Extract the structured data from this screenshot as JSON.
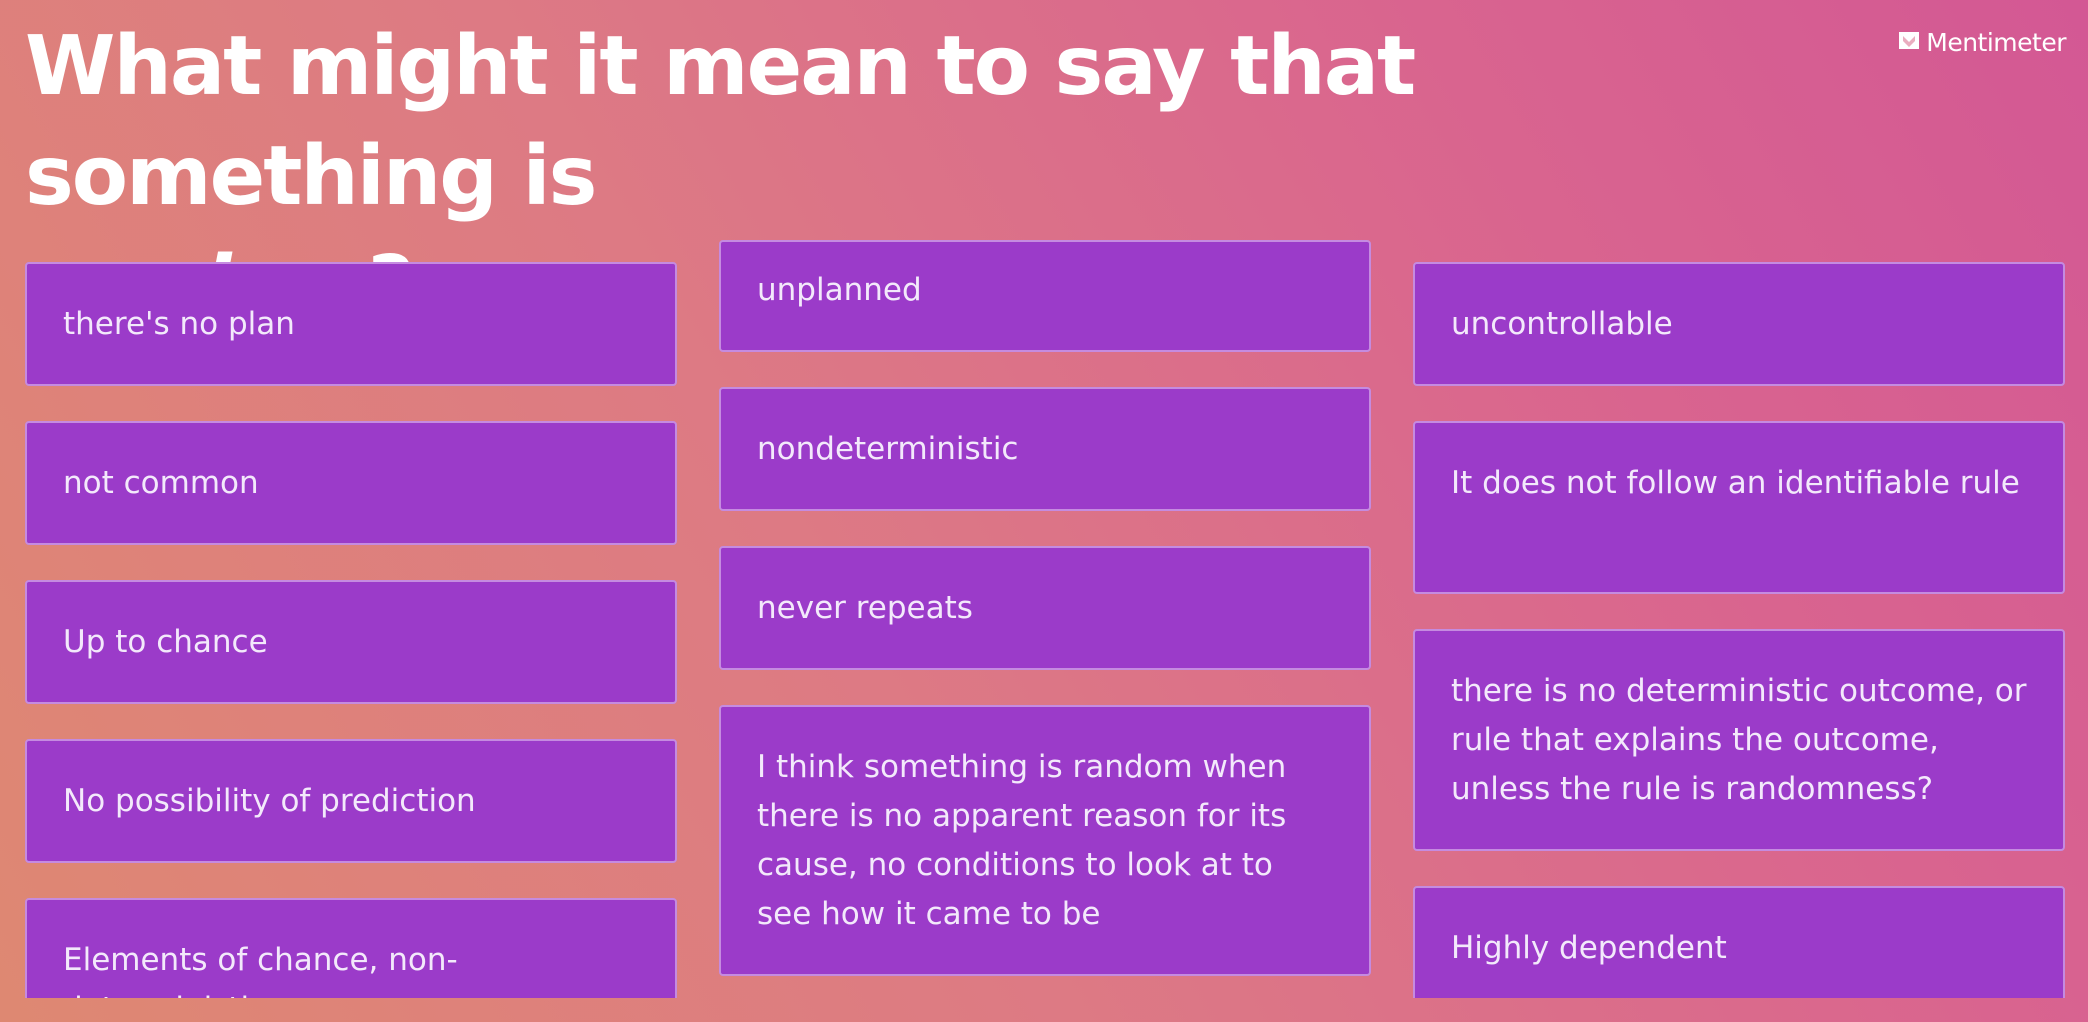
{
  "question": {
    "title_line1": "What might it mean to say that something is",
    "title_emphasis": "random",
    "title_end": "?"
  },
  "brand": {
    "name": "Mentimeter",
    "icon": "mentimeter-logo-icon"
  },
  "responses": {
    "column1": [
      "there's no plan",
      "not common",
      "Up to chance",
      "No possibility of prediction",
      "Elements of chance, non-deterministic"
    ],
    "column2": [
      "unplanned",
      "nondeterministic",
      "never repeats",
      "I think something is random when there is no apparent reason for its cause, no conditions to look at to see how it came to be"
    ],
    "column3": [
      "uncontrollable",
      "It does not follow an identifiable rule",
      "there is no deterministic outcome, or rule that explains the outcome, unless the rule is randomness?",
      "Highly dependent"
    ]
  },
  "colors": {
    "card_background": "#9b3bc9",
    "card_border": "#c58be0",
    "card_text": "#f3e9fb",
    "title_text": "#ffffff"
  }
}
